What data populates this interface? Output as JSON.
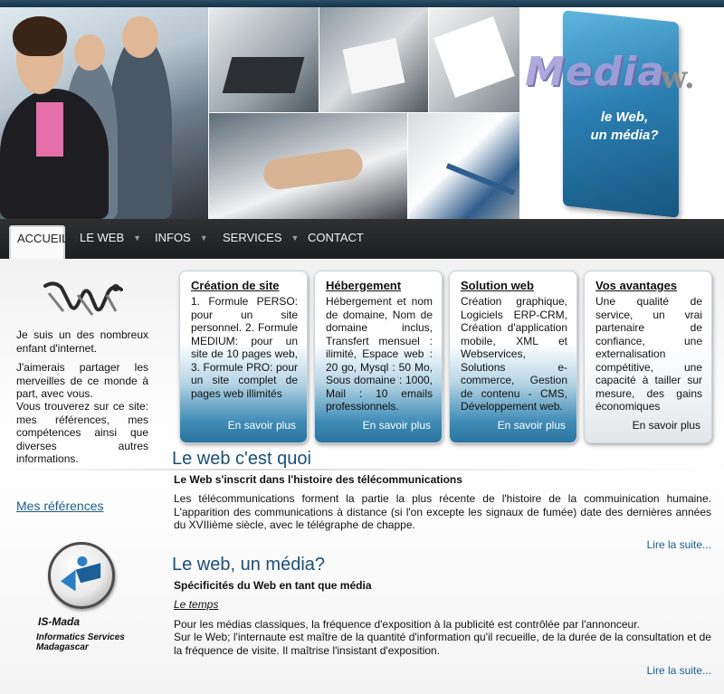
{
  "banner": {
    "logo_word": "Media",
    "logo_w": "w.",
    "tagline_line1": "le Web,",
    "tagline_line2": "un média?"
  },
  "nav": {
    "items": [
      {
        "label": "ACCUEIL",
        "active": true
      },
      {
        "label": "LE WEB",
        "dropdown": true
      },
      {
        "label": "INFOS",
        "dropdown": true
      },
      {
        "label": "SERVICES",
        "dropdown": true
      },
      {
        "label": "CONTACT"
      }
    ],
    "caret": "▼"
  },
  "sidebar": {
    "intro": "Je suis un des nombreux enfant d'internet.",
    "para2": "J'aimerais partager les merveilles de ce monde à part, avec vous.",
    "para3": "Vous trouverez sur ce site: mes références, mes compétences ainsi que diverses autres informations.",
    "references_link": "Mes références",
    "company_name": "IS-Mada",
    "company_line1": "Informatics Services",
    "company_line2": "Madagascar"
  },
  "boxes": [
    {
      "title": "Création de site",
      "body": "1. Formule PERSO: pour un site personnel. 2. Formule MEDIUM: pour un site de 10 pages web, 3. Formule PRO: pour un site complet de pages web illimités",
      "more": "En savoir plus"
    },
    {
      "title": "Hébergement",
      "body": "Hébergement et nom de domaine, Nom de domaine inclus, Transfert mensuel : ilimité, Espace web : 20 go, Mysql : 50 Mo, Sous domaine : 1000, Mail : 10 emails professionnels.",
      "more": "En savoir plus"
    },
    {
      "title": "Solution web",
      "body": "Création graphique, Logiciels ERP-CRM, Création d'application mobile, XML et Webservices, Solutions e-commerce, Gestion de contenu - CMS, Développement web.",
      "more": "En savoir plus"
    },
    {
      "title": "Vos avantages",
      "body": "Une qualité de service, un vrai partenaire de confiance, une externalisation compétitive, une capacité à tailler sur mesure, des gains économiques",
      "more": "En savoir plus"
    }
  ],
  "articles": [
    {
      "title": "Le web c'est quoi",
      "subtitle": "Le Web s'inscrit dans l'histoire des télécommunications",
      "text": "Les télécommunications forment la partie la plus récente de l'histoire de la commuinication humaine. L'apparition des communications à distance (si l'on excepte les signaux de fumée) date des dernières années du XVIIième siècle, avec le télégraphe de chappe.",
      "more": "Lire la suite..."
    },
    {
      "title": "Le web, un média?",
      "subtitle": "Spécificités du Web en tant que média",
      "emphasis": "Le temps",
      "text1": "Pour les médias classiques, la fréquence d'exposition à la publicité est contrôlée par l'annonceur.",
      "text2": "Sur le Web; l'internaute est maître de la quantité d'information qu'il recueille, de la durée de la consultation et de la fréquence de visite. Il maîtrise l'insistant d'exposition.",
      "more": "Lire la suite..."
    }
  ]
}
